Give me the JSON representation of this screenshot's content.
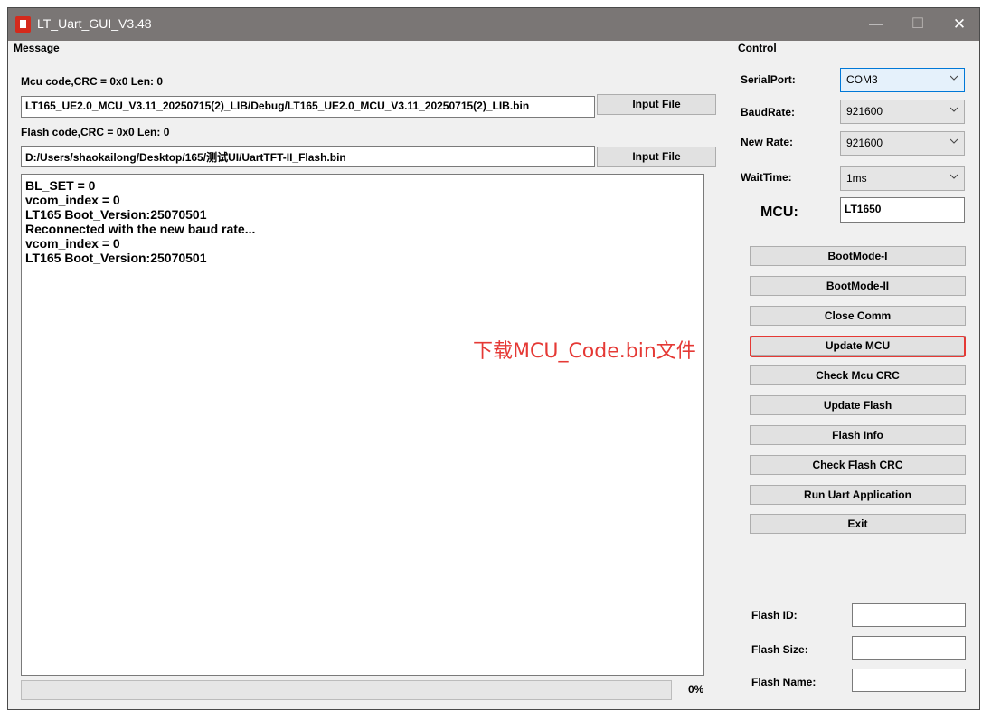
{
  "window": {
    "title": "LT_Uart_GUI_V3.48",
    "minimize_glyph": "—",
    "maximize_glyph": "☐",
    "close_glyph": "✕"
  },
  "message": {
    "group_label": "Message",
    "mcu_code_label": "Mcu code,CRC = 0x0  Len: 0",
    "mcu_file_path": "LT165_UE2.0_MCU_V3.11_20250715(2)_LIB/Debug/LT165_UE2.0_MCU_V3.11_20250715(2)_LIB.bin",
    "mcu_input_button": "Input File",
    "flash_code_label": "Flash code,CRC = 0x0  Len: 0",
    "flash_file_path": "D:/Users/shaokailong/Desktop/165/测试UI/UartTFT-II_Flash.bin",
    "flash_input_button": "Input File",
    "log_lines": [
      "BL_SET = 0",
      "vcom_index = 0",
      "LT165 Boot_Version:25070501",
      "Reconnected with the new baud rate...",
      "vcom_index = 0",
      "LT165 Boot_Version:25070501"
    ],
    "progress_percent": 0,
    "progress_text": "0%"
  },
  "annotation": {
    "text": "下载MCU_Code.bin文件",
    "color": "#e53935"
  },
  "control": {
    "group_label": "Control",
    "serial_port_label": "SerialPort:",
    "serial_port_value": "COM3",
    "baud_rate_label": "BaudRate:",
    "baud_rate_value": "921600",
    "new_rate_label": "New Rate:",
    "new_rate_value": "921600",
    "wait_time_label": "WaitTime:",
    "wait_time_value": "1ms",
    "mcu_label": "MCU:",
    "mcu_value": "LT1650",
    "buttons": {
      "boot_mode_1": "BootMode-I",
      "boot_mode_2": "BootMode-II",
      "close_comm": "Close Comm",
      "update_mcu": "Update MCU",
      "check_mcu_crc": "Check Mcu CRC",
      "update_flash": "Update Flash",
      "flash_info": "Flash Info",
      "check_flash_crc": "Check Flash CRC",
      "run_uart_application": "Run Uart Application",
      "exit": "Exit"
    },
    "flash_id_label": "Flash ID:",
    "flash_id_value": "",
    "flash_size_label": "Flash Size:",
    "flash_size_value": "",
    "flash_name_label": "Flash Name:",
    "flash_name_value": ""
  },
  "colors": {
    "title_bar": "#7a7675",
    "highlight": "#e53935",
    "focus_border": "#0078d7"
  },
  "icons": [
    "app-logo-icon",
    "chevron-down-icon"
  ]
}
